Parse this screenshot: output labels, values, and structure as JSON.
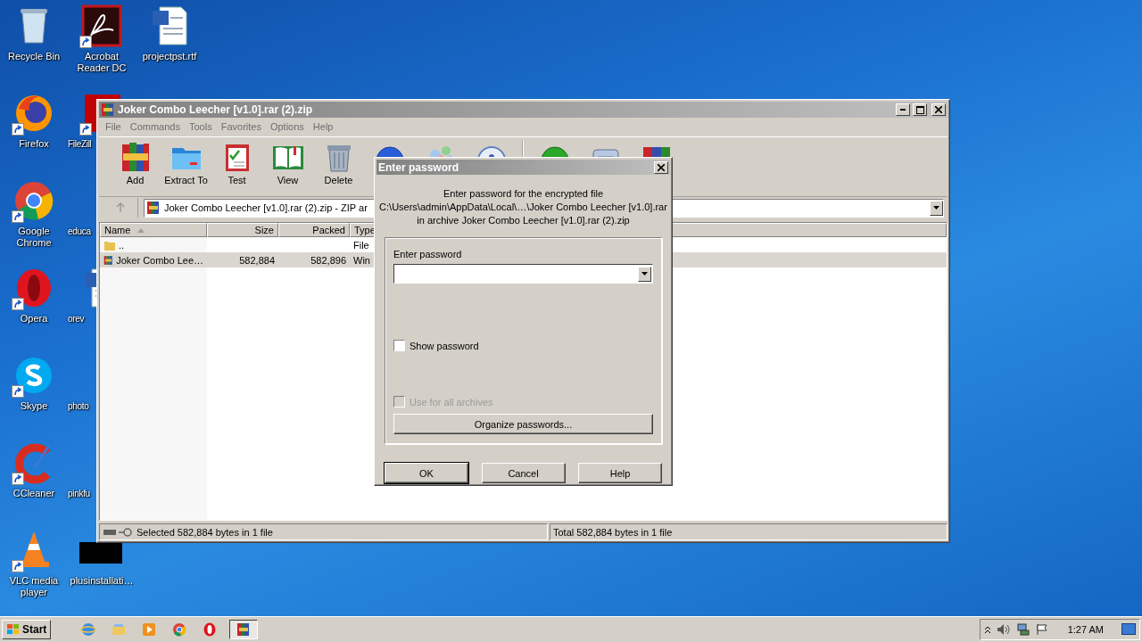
{
  "desktop": {
    "icons": [
      {
        "label": "Recycle Bin",
        "kind": "recycle",
        "clipped": false
      },
      {
        "label": "Firefox",
        "kind": "firefox",
        "clipped": false
      },
      {
        "label": "Google Chrome",
        "kind": "chrome",
        "clipped": false
      },
      {
        "label": "Opera",
        "kind": "opera",
        "clipped": false
      },
      {
        "label": "Skype",
        "kind": "skype",
        "clipped": false
      },
      {
        "label": "CCleaner",
        "kind": "ccleaner",
        "clipped": false
      },
      {
        "label": "VLC media player",
        "kind": "vlc",
        "clipped": false
      },
      {
        "label": "Acrobat Reader DC",
        "kind": "acrobat",
        "clipped": false
      },
      {
        "label": "FileZill",
        "kind": "filezilla",
        "clipped": true
      },
      {
        "label": "educa",
        "kind": "blank",
        "clipped": true
      },
      {
        "label": "orev",
        "kind": "word",
        "clipped": true
      },
      {
        "label": "photo",
        "kind": "blank",
        "clipped": true
      },
      {
        "label": "pinkfu",
        "kind": "blank",
        "clipped": true
      },
      {
        "label": "plusinstallati…",
        "kind": "black",
        "clipped": false
      },
      {
        "label": "projectpst.rtf",
        "kind": "word",
        "clipped": false
      }
    ]
  },
  "window": {
    "title": "Joker Combo Leecher [v1.0].rar (2).zip",
    "menu": [
      "File",
      "Commands",
      "Tools",
      "Favorites",
      "Options",
      "Help"
    ],
    "toolbar": [
      {
        "label": "Add",
        "kind": "add"
      },
      {
        "label": "Extract To",
        "kind": "extract"
      },
      {
        "label": "Test",
        "kind": "test"
      },
      {
        "label": "View",
        "kind": "view"
      },
      {
        "label": "Delete",
        "kind": "delete"
      },
      {
        "kind": "find"
      },
      {
        "kind": "wizard"
      },
      {
        "kind": "info"
      },
      {
        "kind": "virus"
      },
      {
        "kind": "comment"
      },
      {
        "kind": "sfx"
      }
    ],
    "address": "Joker Combo Leecher [v1.0].rar (2).zip - ZIP ar",
    "columns": [
      "Name",
      "Size",
      "Packed",
      "Type"
    ],
    "rows": [
      {
        "name": "..",
        "size": null,
        "packed": null,
        "type": "File",
        "kind": "folder",
        "selected": false
      },
      {
        "name": "Joker Combo Lee…",
        "size": "582,884",
        "packed": "582,896",
        "type": "Win",
        "kind": "archive",
        "selected": true
      }
    ],
    "status_left": "Selected 582,884 bytes in 1 file",
    "status_right": "Total 582,884 bytes in 1 file"
  },
  "dialog": {
    "title": "Enter password",
    "message": [
      "Enter password for the encrypted file",
      "C:\\Users\\admin\\AppData\\Local\\…\\Joker Combo Leecher [v1.0].rar",
      "in archive Joker Combo Leecher [v1.0].rar (2).zip"
    ],
    "field_label": "Enter password",
    "show_password": {
      "label": "Show password",
      "checked": false,
      "disabled": false
    },
    "use_for_all": {
      "label": "Use for all archives",
      "checked": false,
      "disabled": true
    },
    "organize": "Organize passwords...",
    "buttons": [
      "OK",
      "Cancel",
      "Help"
    ]
  },
  "taskbar": {
    "start": "Start",
    "apps": [
      {
        "kind": "ie",
        "selected": false
      },
      {
        "kind": "explorer",
        "selected": false
      },
      {
        "kind": "media",
        "selected": false
      },
      {
        "kind": "chrome",
        "selected": false
      },
      {
        "kind": "opera",
        "selected": false
      },
      {
        "kind": "winrar",
        "selected": true
      }
    ],
    "time": "1:27 AM"
  }
}
